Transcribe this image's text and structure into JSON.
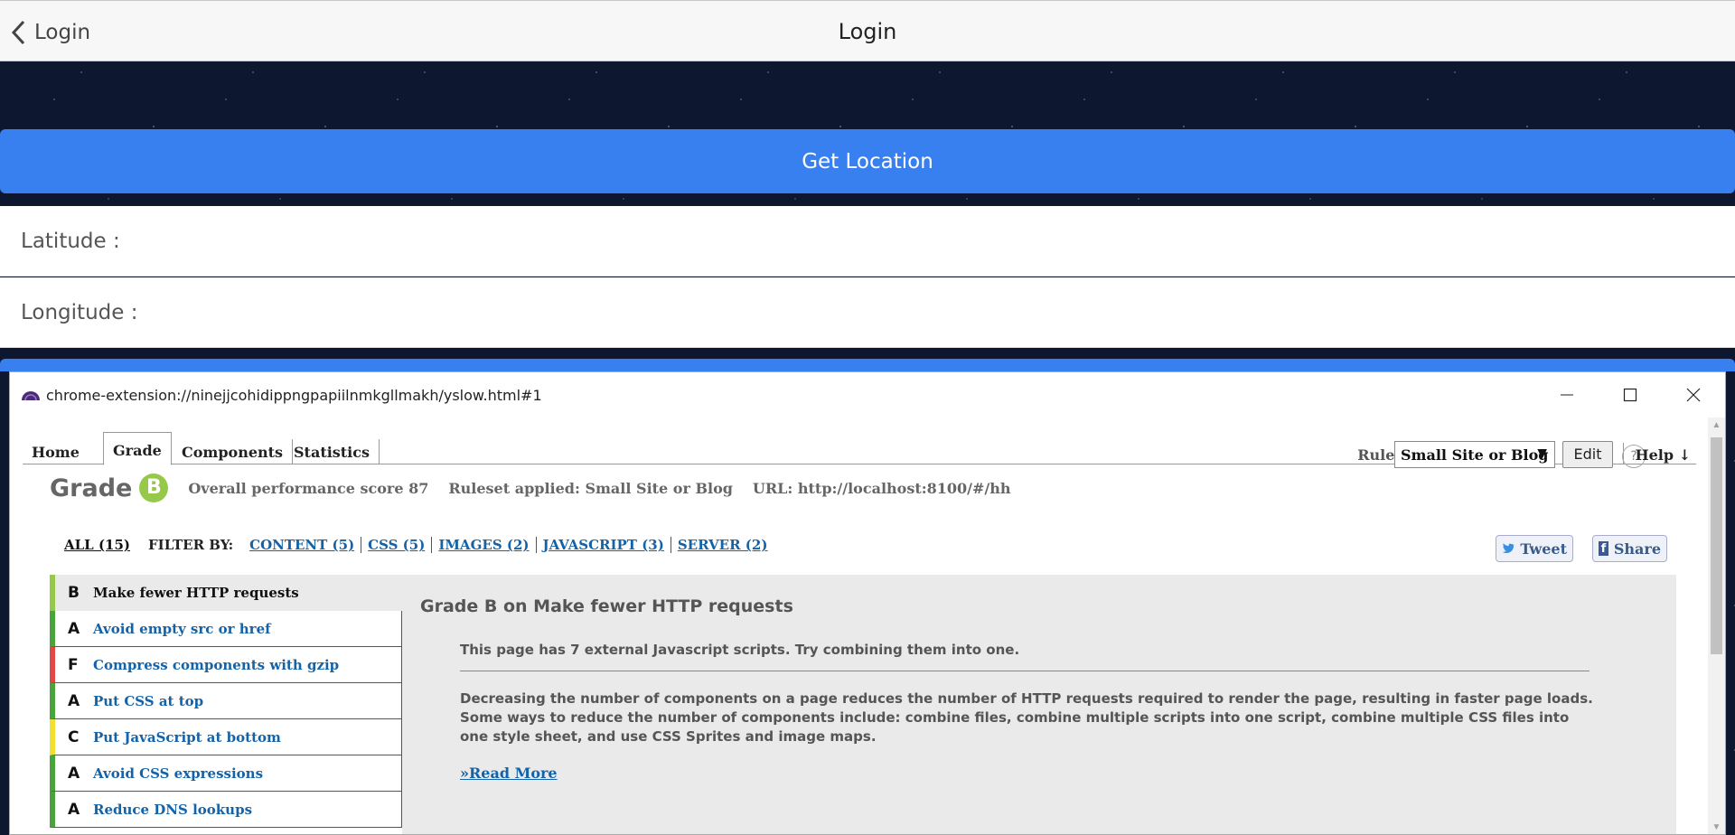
{
  "app": {
    "back_label": "Login",
    "title": "Login",
    "get_location_label": "Get Location",
    "latitude_label": "Latitude :",
    "longitude_label": "Longitude :",
    "accent_color": "#3880f0"
  },
  "popup": {
    "url": "chrome-extension://ninejjcohidippngpapiilnmkgllmakh/yslow.html#1",
    "tabs": [
      {
        "label": "Home"
      },
      {
        "label": "Grade"
      },
      {
        "label": "Components"
      },
      {
        "label": "Statistics"
      }
    ],
    "rulesets_label": "Rulesets",
    "ruleset_selected": "Small Site or Blog",
    "edit_label": "Edit",
    "help_icon_label": "?",
    "help_label": "Help ↓",
    "grade_word": "Grade",
    "grade_letter": "B",
    "overall_score": "Overall performance score 87",
    "ruleset_applied": "Ruleset applied: Small Site or Blog",
    "page_url": "URL: http://localhost:8100/#/hh",
    "filter_all": "ALL (15)",
    "filter_by": "FILTER BY:",
    "filters": [
      "CONTENT (5)",
      "CSS (5)",
      "IMAGES (2)",
      "JAVASCRIPT (3)",
      "SERVER (2)"
    ],
    "tweet_label": "Tweet",
    "share_label": "Share",
    "fb_letter": "f",
    "grade_colors": {
      "A": "#4aa43c",
      "B": "#96c84a",
      "C": "#f0e030",
      "F": "#e04848"
    },
    "rules": [
      {
        "grade": "B",
        "label": "Make fewer HTTP requests"
      },
      {
        "grade": "A",
        "label": "Avoid empty src or href"
      },
      {
        "grade": "F",
        "label": "Compress components with gzip"
      },
      {
        "grade": "A",
        "label": "Put CSS at top"
      },
      {
        "grade": "C",
        "label": "Put JavaScript at bottom"
      },
      {
        "grade": "A",
        "label": "Avoid CSS expressions"
      },
      {
        "grade": "A",
        "label": "Reduce DNS lookups"
      }
    ],
    "detail": {
      "title": "Grade B on Make fewer HTTP requests",
      "message": "This page has 7 external Javascript scripts. Try combining them into one.",
      "description": "Decreasing the number of components on a page reduces the number of HTTP requests required to render the page, resulting in faster page loads. Some ways to reduce the number of components include: combine files, combine multiple scripts into one script, combine multiple CSS files into one style sheet, and use CSS Sprites and image maps.",
      "read_more": "»Read More"
    }
  }
}
